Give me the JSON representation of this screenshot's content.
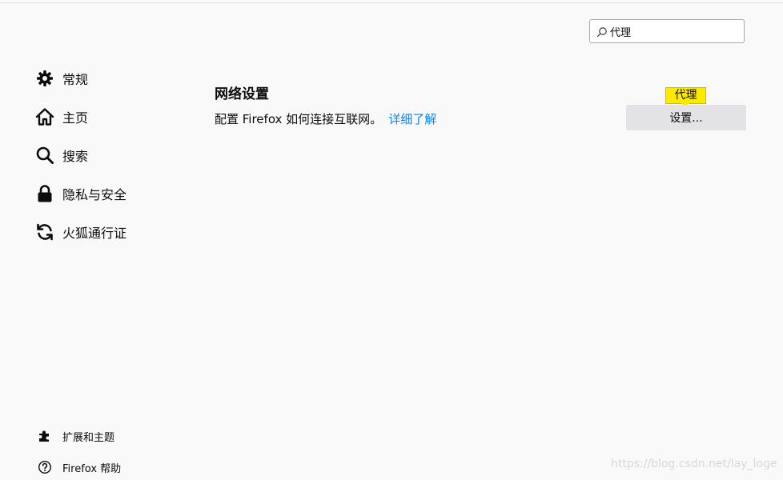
{
  "search": {
    "value": "代理",
    "icon": "search-icon"
  },
  "sidebar": {
    "items": [
      {
        "label": "常规",
        "icon": "gear-icon"
      },
      {
        "label": "主页",
        "icon": "home-icon"
      },
      {
        "label": "搜索",
        "icon": "search-icon"
      },
      {
        "label": "隐私与安全",
        "icon": "lock-icon"
      },
      {
        "label": "火狐通行证",
        "icon": "sync-icon"
      }
    ],
    "footer": [
      {
        "label": "扩展和主题",
        "icon": "puzzle-icon"
      },
      {
        "label": "Firefox 帮助",
        "icon": "help-icon"
      }
    ]
  },
  "main": {
    "section_title": "网络设置",
    "description": "配置 Firefox 如何连接互联网。",
    "learn_more": "详细了解",
    "tooltip": "代理",
    "settings_button": "设置..."
  },
  "watermark": "https://blog.csdn.net/lay_loge",
  "colors": {
    "background": "#f9f9fa",
    "link": "#0a84ff",
    "tooltip": "#ffe900",
    "button": "#e3e3e5"
  }
}
